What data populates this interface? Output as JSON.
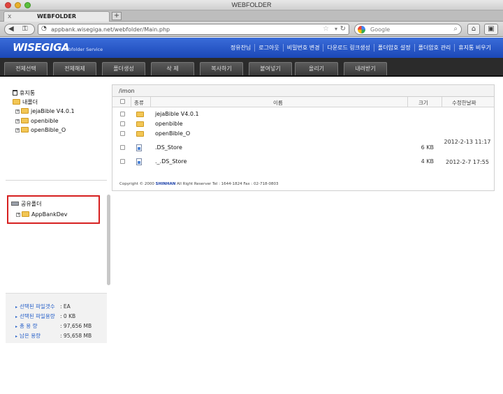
{
  "window": {
    "title": "WEBFOLDER"
  },
  "tab": {
    "label": "WEBFOLDER",
    "close": "x",
    "new_tab": "+"
  },
  "toolbar": {
    "url": "appbank.wisegiga.net/webfolder/Main.php",
    "search_placeholder": "Google"
  },
  "site": {
    "logo": "WISEGIGA",
    "logo_sub": "Webfolder Service",
    "topnav": [
      "정유찬님",
      "로그아웃",
      "비밀번호 변경",
      "다운로드 링크생성",
      "폴더암호 설정",
      "폴더암호 관리",
      "휴지통 비우기"
    ]
  },
  "actions": [
    "전체선택",
    "전체해제",
    "폴더생성",
    "삭    제",
    "복사하기",
    "붙여넣기",
    "올리기",
    "내려받기"
  ],
  "left": {
    "trash": "휴지통",
    "my_folder": "내폴더",
    "folders": [
      "jejaBible V4.0.1",
      "openbible",
      "openBible_O"
    ],
    "shared_folder": "공유폴더",
    "shared_items": [
      "AppBankDev"
    ]
  },
  "stats": [
    {
      "label": "선택된 파일갯수",
      "value": ": EA"
    },
    {
      "label": "선택된 파일용량",
      "value": ": 0 KB"
    },
    {
      "label": "총 용 량",
      "value": ": 97,656 MB"
    },
    {
      "label": "남은 용량",
      "value": ": 95,658 MB"
    }
  ],
  "files": {
    "path": "/imon",
    "headers": {
      "type": "종류",
      "name": "이름",
      "size": "크기",
      "modified": "수정한날짜"
    },
    "rows": [
      {
        "kind": "folder",
        "name": "jejaBible V4.0.1",
        "size": "",
        "date": ""
      },
      {
        "kind": "folder",
        "name": "openbible",
        "size": "",
        "date": ""
      },
      {
        "kind": "folder",
        "name": "openBible_O",
        "size": "",
        "date": ""
      },
      {
        "kind": "file",
        "name": ".DS_Store",
        "size": "6 KB",
        "date": "2012-2-13 11:17"
      },
      {
        "kind": "file",
        "name": "._.DS_Store",
        "size": "4 KB",
        "date": "2012-2-7 17:55"
      }
    ],
    "copyright_prefix": "Copyright © 2000",
    "copyright_brand": "SHINHAN",
    "copyright_rest": "All Right Reserver Tel : 1644-1824 Fax : 02-718-0803"
  }
}
